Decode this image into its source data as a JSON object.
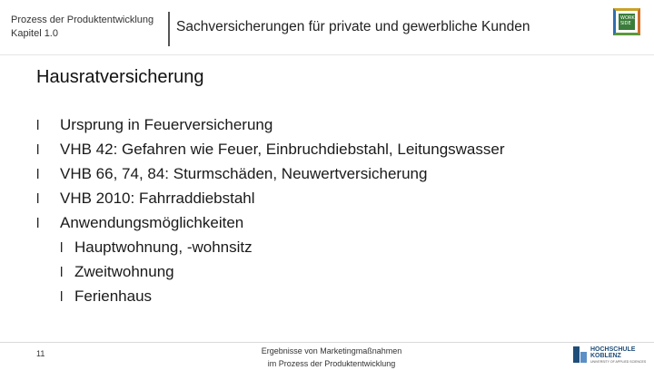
{
  "header": {
    "left_line1": "Prozess der Produktentwicklung",
    "left_line2": "Kapitel 1.0",
    "title": "Sachversicherungen für private und gewerbliche Kunden",
    "logo_text": "WORK SIDE"
  },
  "main": {
    "heading": "Hausratversicherung",
    "bullet_marker": "l",
    "bullets": [
      {
        "text": "Ursprung in Feuerversicherung",
        "level": 1
      },
      {
        "text": "VHB 42: Gefahren wie Feuer, Einbruchdiebstahl, Leitungswasser",
        "level": 1
      },
      {
        "text": "VHB 66, 74, 84: Sturmschäden, Neuwertversicherung",
        "level": 1
      },
      {
        "text": "VHB 2010: Fahrraddiebstahl",
        "level": 1
      },
      {
        "text": "Anwendungsmöglichkeiten",
        "level": 1
      },
      {
        "text": "Hauptwohnung, -wohnsitz",
        "level": 2
      },
      {
        "text": "Zweitwohnung",
        "level": 2
      },
      {
        "text": "Ferienhaus",
        "level": 2
      }
    ]
  },
  "footer": {
    "page_number": "11",
    "center_line1": "Ergebnisse von Marketingmaßnahmen",
    "center_line2": "im Prozess der Produktentwicklung",
    "logo_line1": "HOCHSCHULE",
    "logo_line2": "KOBLENZ",
    "logo_sub": "UNIVERSITY OF APPLIED SCIENCES"
  },
  "colors": {
    "logo_blue": "#1f4e79",
    "logo_green": "#3a7d3a",
    "logo_orange": "#d0702a"
  }
}
